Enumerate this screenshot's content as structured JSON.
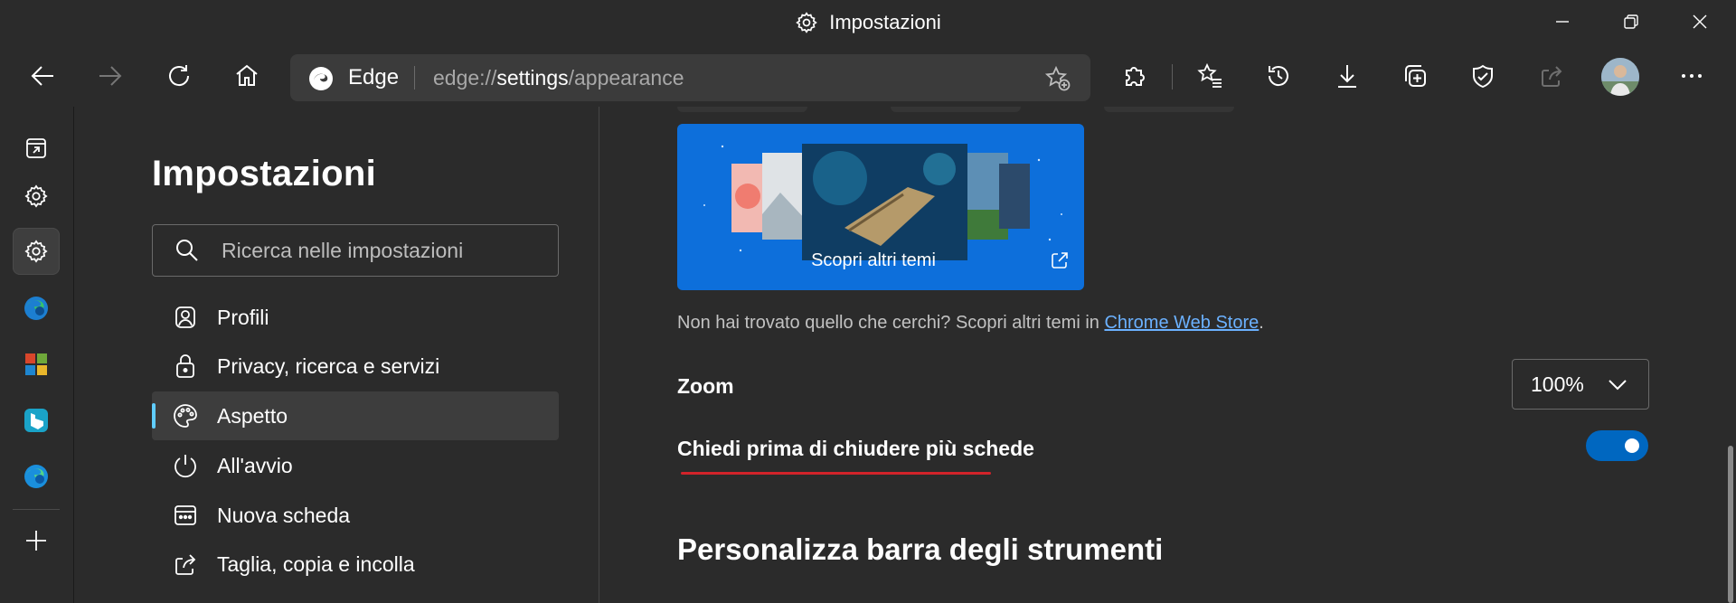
{
  "window": {
    "title": "Impostazioni",
    "controls": [
      "minimize-icon",
      "restore-icon",
      "close-icon"
    ]
  },
  "toolbar": {
    "address": {
      "brand": "Edge",
      "url_scheme": "edge://",
      "url_host": "settings",
      "url_path": "/appearance"
    },
    "icons": [
      "back-icon",
      "forward-icon",
      "refresh-icon",
      "home-icon",
      "add-favorite-icon",
      "extensions-icon",
      "favorites-icon",
      "history-icon",
      "downloads-icon",
      "collections-icon",
      "browser-essentials-icon",
      "share-icon",
      "profile-avatar",
      "more-icon"
    ]
  },
  "sidebar": {
    "icons": [
      "workspaces-icon",
      "settings-icon",
      "settings-active-icon",
      "edge-dev-icon",
      "office-icon",
      "bing-icon",
      "edge-icon",
      "add-icon"
    ]
  },
  "nav": {
    "title": "Impostazioni",
    "search_placeholder": "Ricerca nelle impostazioni",
    "items": [
      {
        "label": "Profili",
        "icon": "profile-icon"
      },
      {
        "label": "Privacy, ricerca e servizi",
        "icon": "lock-icon"
      },
      {
        "label": "Aspetto",
        "icon": "palette-icon",
        "active": true
      },
      {
        "label": "All'avvio",
        "icon": "power-icon"
      },
      {
        "label": "Nuova scheda",
        "icon": "new-tab-icon"
      },
      {
        "label": "Taglia, copia e incolla",
        "icon": "share-out-icon"
      }
    ]
  },
  "content": {
    "themes_card_caption": "Scopri altri temi",
    "hint_prefix": "Non hai trovato quello che cerchi? Scopri altri temi in ",
    "hint_link": "Chrome Web Store",
    "hint_suffix": ".",
    "zoom_label": "Zoom",
    "zoom_value": "100%",
    "ask_close_label": "Chiedi prima di chiudere più schede",
    "ask_close_enabled": true,
    "section_heading": "Personalizza barra degli strumenti"
  },
  "colors": {
    "background": "#2b2b2b",
    "accent": "#0067c0",
    "link": "#6bb1ff",
    "underline_mark": "#d2232a",
    "theme_card": "#0d6fdb"
  }
}
